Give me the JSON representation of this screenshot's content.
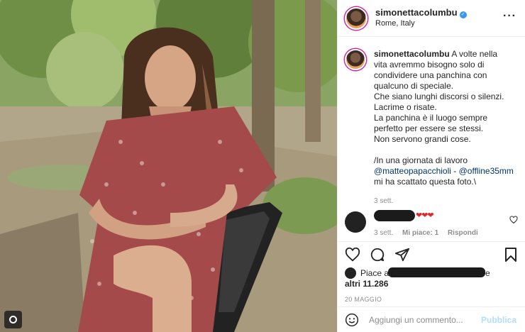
{
  "post": {
    "username": "simonettacolumbu",
    "location": "Rome, Italy",
    "verified_icon": "verified-check-icon",
    "more_icon": "more-horizontal-icon"
  },
  "caption": {
    "username": "simonettacolumbu",
    "lines": [
      "A volte nella",
      "vita avremmo bisogno solo di",
      "condividere una panchina con",
      "qualcuno di speciale.",
      "Che siano lunghi discorsi o silenzi.",
      "Lacrime o risate.",
      "La panchina è il luogo sempre",
      "perfetto per essere se stessi.",
      "Non servono grandi cose."
    ],
    "credit_prefix": "/In una giornata di lavoro",
    "mention1": "@matteopapacchioli",
    "separator": " - ",
    "mention2": "@offline35mm",
    "credit_suffix": "mi ha scattato questa foto.\\",
    "time": "3 sett."
  },
  "comment": {
    "hearts": "❤❤❤",
    "time": "3 sett.",
    "likes": "Mi piace: 1",
    "reply": "Rispondi"
  },
  "likes": {
    "prefix": "Piace a",
    "suffix": "e",
    "count_line": "altri 11.286"
  },
  "date": "20 MAGGIO",
  "add_comment": {
    "placeholder": "Aggiungi un commento...",
    "publish": "Pubblica"
  },
  "colors": {
    "link": "#00376b",
    "publish_disabled": "#b2dffc",
    "verified": "#3897f0",
    "heart": "#e0262d"
  }
}
